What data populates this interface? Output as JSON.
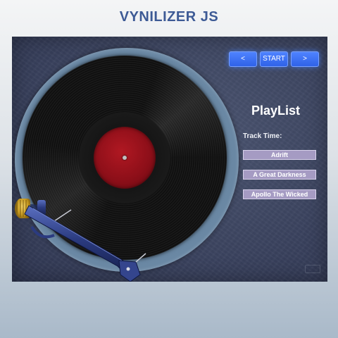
{
  "app": {
    "title": "VYNILIZER JS"
  },
  "controls": {
    "prev_label": "<",
    "start_label": "START",
    "next_label": ">"
  },
  "playlist": {
    "title": "PlayList",
    "track_time_label": "Track Time:",
    "tracks": [
      {
        "title": "Adrift"
      },
      {
        "title": "A Great Darkness"
      },
      {
        "title": "Apollo The Wicked"
      }
    ]
  },
  "colors": {
    "title": "#3d5a95",
    "stage_bg": "#3c4460",
    "button": "#3a6cf2",
    "track_item": "#a59bc3",
    "record_label": "#9a121c",
    "counterweight": "#c8a025",
    "tonearm": "#2e3f83"
  },
  "icons": [
    "tonearm",
    "counterweight",
    "vinyl-record"
  ]
}
